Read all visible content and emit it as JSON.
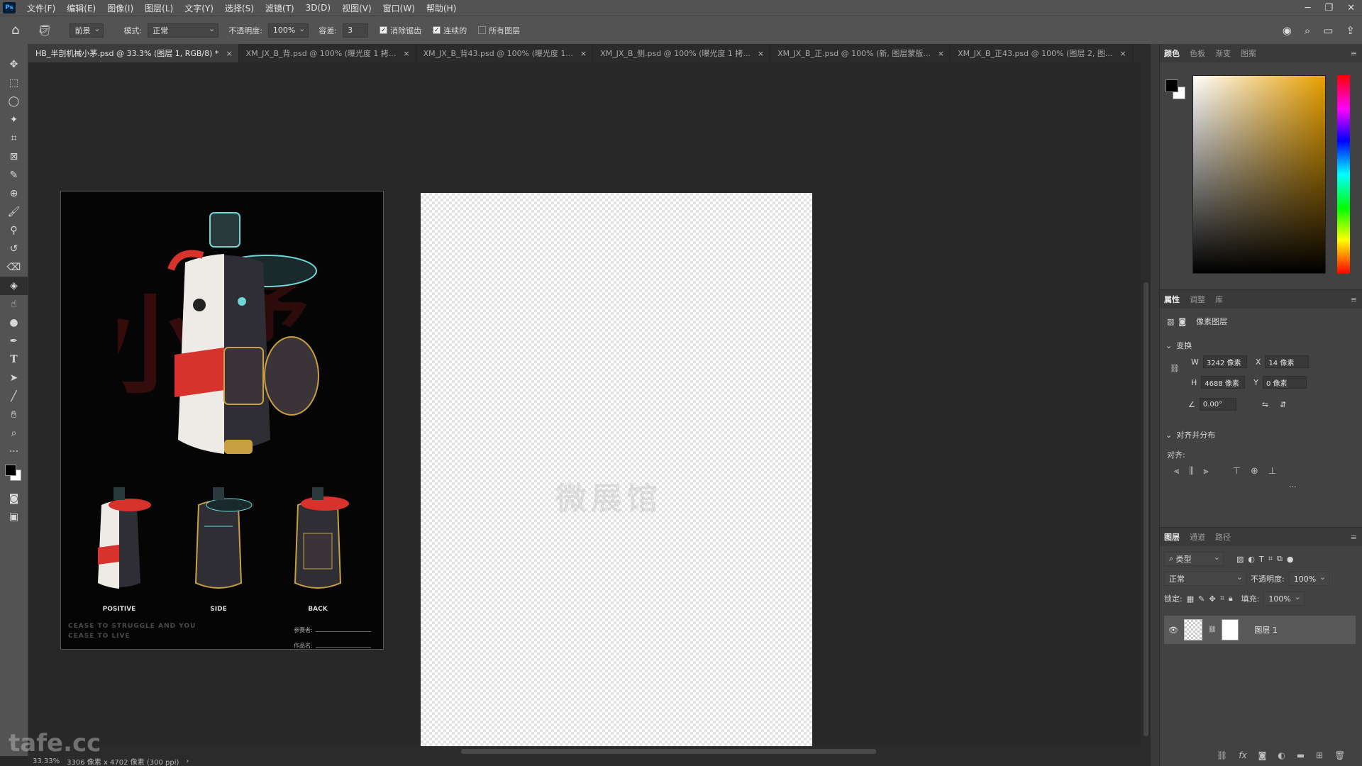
{
  "menubar": {
    "logo": "Ps",
    "items": [
      "文件(F)",
      "编辑(E)",
      "图像(I)",
      "图层(L)",
      "文字(Y)",
      "选择(S)",
      "滤镜(T)",
      "3D(D)",
      "视图(V)",
      "窗口(W)",
      "帮助(H)"
    ]
  },
  "options": {
    "fill_source": "前景",
    "mode_label": "模式:",
    "mode_value": "正常",
    "opacity_label": "不透明度:",
    "opacity_value": "100%",
    "tolerance_label": "容差:",
    "tolerance_value": "3",
    "antialias_label": "消除锯齿",
    "antialias_checked": true,
    "contiguous_label": "连续的",
    "contiguous_checked": true,
    "all_layers_label": "所有图层",
    "all_layers_checked": false
  },
  "tabs": [
    {
      "label": "HB_半剖机械小茅.psd @ 33.3% (图层 1, RGB/8) *",
      "active": true
    },
    {
      "label": "XM_JX_B_背.psd @ 100% (曝光度 1 拷...",
      "active": false
    },
    {
      "label": "XM_JX_B_背43.psd @ 100% (曝光度 1...",
      "active": false
    },
    {
      "label": "XM_JX_B_侧.psd @ 100% (曝光度 1 拷...",
      "active": false
    },
    {
      "label": "XM_JX_B_正.psd @ 100% (新, 图层蒙版...",
      "active": false
    },
    {
      "label": "XM_JX_B_正43.psd @ 100% (图层 2, 图...",
      "active": false
    }
  ],
  "reference_poster": {
    "captions": [
      "POSITIVE",
      "SIDE",
      "BACK"
    ],
    "slogan_line1": "CEASE TO STRUGGLE AND YOU",
    "slogan_line2": "CEASE TO LIVE",
    "entrant_label": "参赛者:",
    "work_label": "作品名:"
  },
  "canvas": {
    "ghost_title": "微展馆"
  },
  "status": {
    "zoom": "33.33%",
    "doc_size": "3306 像素 x 4702 像素 (300 ppi)"
  },
  "watermark": "tafe.cc",
  "color_panel": {
    "tabs": [
      "颜色",
      "色板",
      "渐变",
      "图案"
    ],
    "active_tab": "颜色"
  },
  "properties_panel": {
    "tabs": [
      "属性",
      "调整",
      "库"
    ],
    "layer_type": "像素图层",
    "transform_title": "变换",
    "w_label": "W",
    "w_value": "3242 像素",
    "x_label": "X",
    "x_value": "14 像素",
    "h_label": "H",
    "h_value": "4688 像素",
    "y_label": "Y",
    "y_value": "0 像素",
    "angle_value": "0.00°",
    "align_title": "对齐并分布",
    "align_label": "对齐:",
    "more": "..."
  },
  "layers_panel": {
    "tabs": [
      "图层",
      "通道",
      "路径"
    ],
    "filter_label": "类型",
    "blend_mode": "正常",
    "opacity_label": "不透明度:",
    "opacity_value": "100%",
    "lock_label": "锁定:",
    "fill_label": "填充:",
    "fill_value": "100%",
    "layers": [
      {
        "name": "图层 1",
        "visible": true
      }
    ]
  },
  "colors": {
    "ui_dark": "#282828",
    "panel": "#424242",
    "toolbar": "#535353",
    "accent_red": "#d8322c"
  }
}
